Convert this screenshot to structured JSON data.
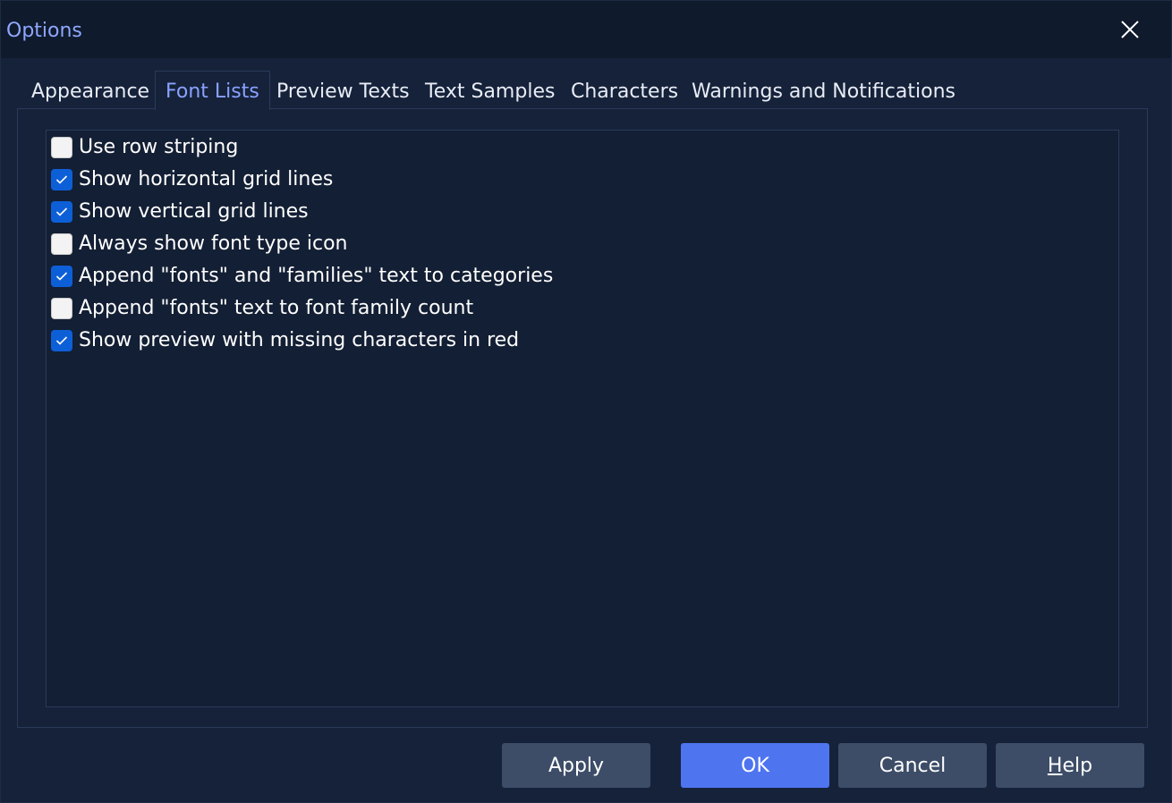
{
  "window": {
    "title": "Options"
  },
  "tabs": [
    {
      "label": "Appearance",
      "active": false
    },
    {
      "label": "Font Lists",
      "active": true
    },
    {
      "label": "Preview Texts",
      "active": false
    },
    {
      "label": "Text Samples",
      "active": false
    },
    {
      "label": "Characters",
      "active": false
    },
    {
      "label": "Warnings and Notifications",
      "active": false
    }
  ],
  "options": [
    {
      "label": "Use row striping",
      "checked": false
    },
    {
      "label": "Show horizontal grid lines",
      "checked": true
    },
    {
      "label": "Show vertical grid lines",
      "checked": true
    },
    {
      "label": "Always show font type icon",
      "checked": false
    },
    {
      "label": "Append \"fonts\" and \"families\" text to categories",
      "checked": true
    },
    {
      "label": "Append \"fonts\" text to font family count",
      "checked": false
    },
    {
      "label": "Show preview with missing characters in red",
      "checked": true
    }
  ],
  "buttons": {
    "apply": "Apply",
    "ok": "OK",
    "cancel": "Cancel",
    "help_first": "H",
    "help_rest": "elp"
  },
  "colors": {
    "accent": "#4f74f0",
    "title": "#8fa7ff",
    "checkbox_checked": "#0d5fd8",
    "background": "#15223a"
  },
  "icons": {
    "close": "close-icon",
    "check": "checkmark-icon"
  }
}
